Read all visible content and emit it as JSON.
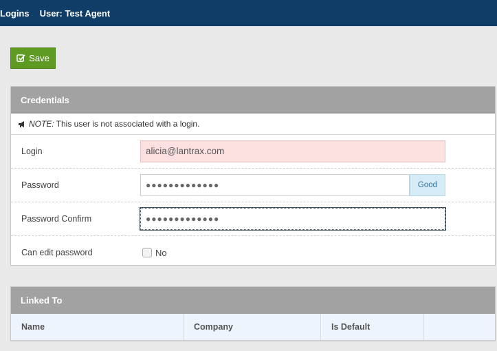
{
  "topbar": {
    "breadcrumb": "Logins",
    "user_label": "User: Test Agent"
  },
  "toolbar": {
    "save_label": "Save"
  },
  "credentials": {
    "title": "Credentials",
    "note_prefix": "NOTE:",
    "note_text": "This user is not associated with a login.",
    "login_label": "Login",
    "login_value": "alicia@lantrax.com",
    "password_label": "Password",
    "password_value": "●●●●●●●●●●●●●",
    "password_strength": "Good",
    "confirm_label": "Password Confirm",
    "confirm_value": "●●●●●●●●●●●●●",
    "can_edit_label": "Can edit password",
    "can_edit_value": "No"
  },
  "linked": {
    "title": "Linked To",
    "columns": [
      "Name",
      "Company",
      "Is Default",
      ""
    ]
  },
  "colors": {
    "topbar": "#0f3d68",
    "save": "#5f9a23",
    "panel_header": "#a2a2a2"
  },
  "icons": {
    "save": "check-square-icon",
    "note": "megaphone-icon"
  }
}
